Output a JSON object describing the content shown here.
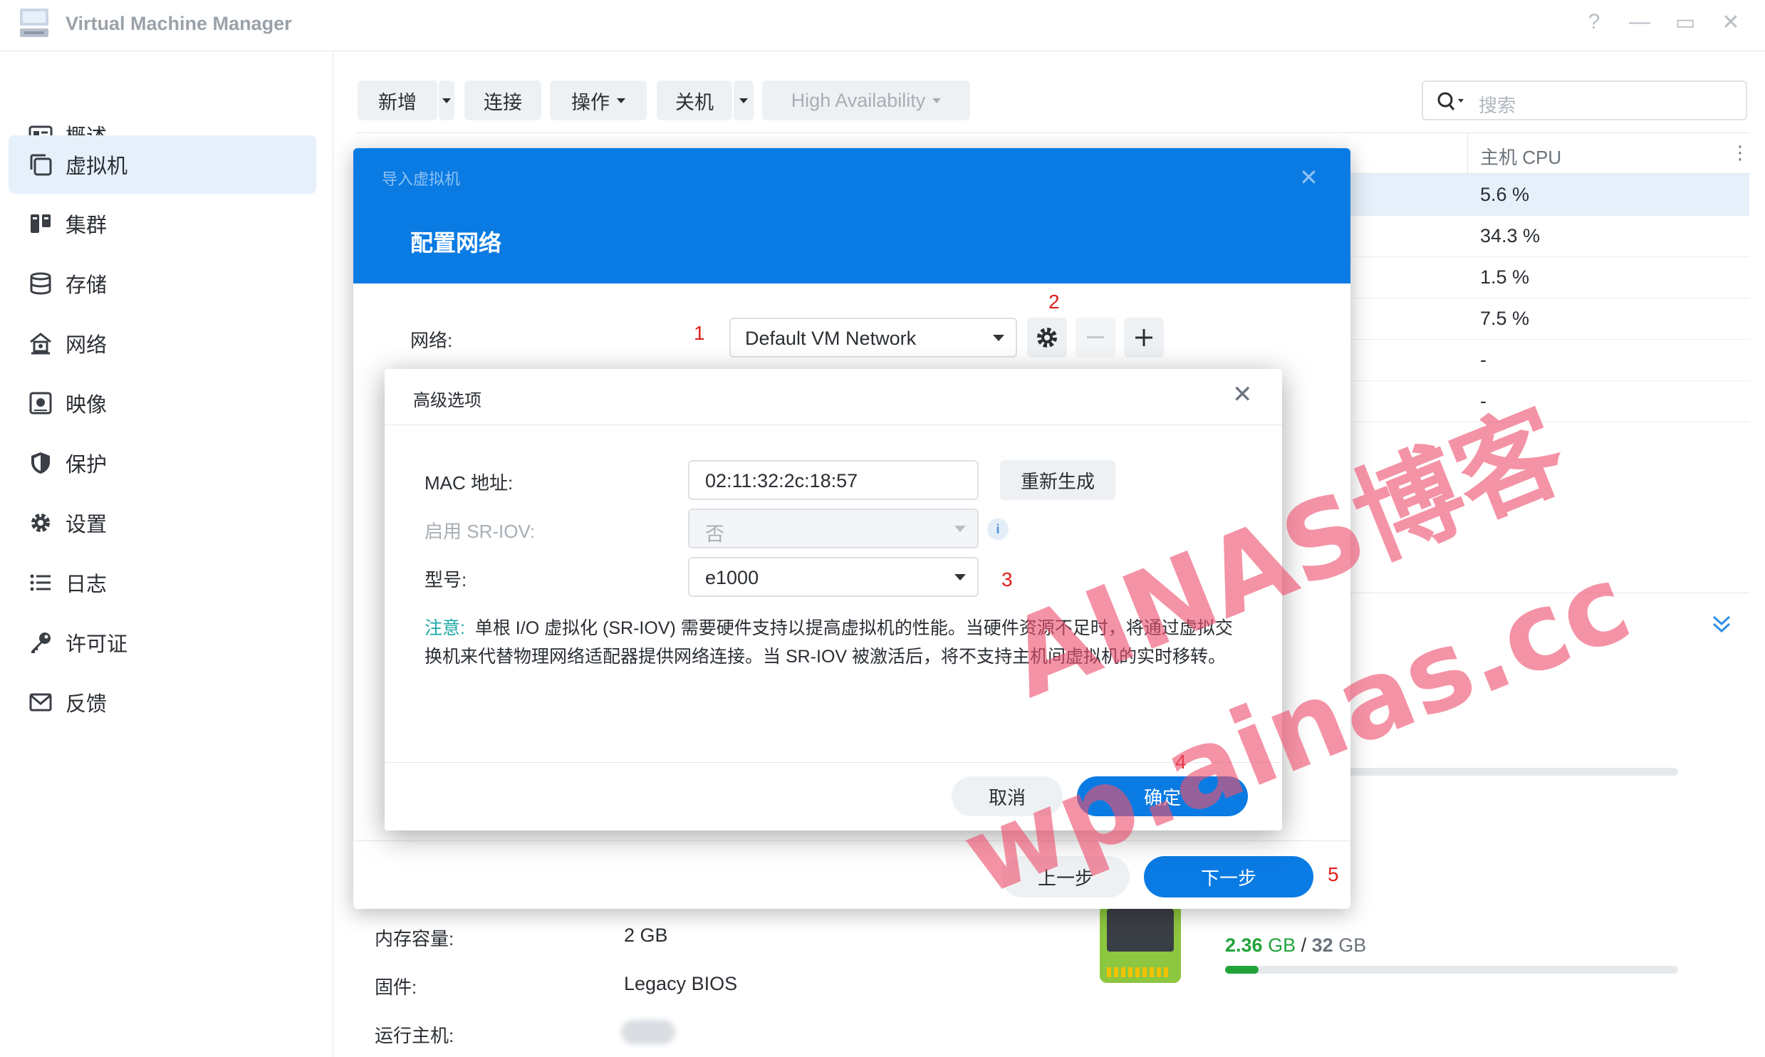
{
  "app": {
    "title": "Virtual Machine Manager"
  },
  "window_controls": {
    "help": "?",
    "minimize": "—",
    "maximize": "▭",
    "close": "✕"
  },
  "sidebar": {
    "items": [
      {
        "label": "概述",
        "icon": "overview-icon"
      },
      {
        "label": "虚拟机",
        "icon": "vm-icon",
        "active": true
      },
      {
        "label": "集群",
        "icon": "cluster-icon"
      },
      {
        "label": "存储",
        "icon": "storage-icon"
      },
      {
        "label": "网络",
        "icon": "network-icon"
      },
      {
        "label": "映像",
        "icon": "image-icon"
      },
      {
        "label": "保护",
        "icon": "shield-icon"
      },
      {
        "label": "设置",
        "icon": "gear-icon"
      },
      {
        "label": "日志",
        "icon": "log-icon"
      },
      {
        "label": "许可证",
        "icon": "key-icon"
      },
      {
        "label": "反馈",
        "icon": "mail-icon"
      }
    ]
  },
  "toolbar": {
    "add": "新增",
    "connect": "连接",
    "action": "操作",
    "shutdown": "关机",
    "ha": "High Availability",
    "search_placeholder": "搜索"
  },
  "table": {
    "host_cpu_header": "主机 CPU",
    "host_cpu_values": [
      "5.6 %",
      "34.3 %",
      "1.5 %",
      "7.5 %",
      "-",
      "-"
    ]
  },
  "details": {
    "memory_label": "内存容量:",
    "memory_value": "2 GB",
    "firmware_label": "固件:",
    "firmware_value": "Legacy BIOS",
    "host_label": "运行主机:",
    "host_memory_used": "2.36",
    "host_memory_unit1": "GB",
    "host_memory_sep": "/",
    "host_memory_total": "32",
    "host_memory_unit2": "GB",
    "host_memory_fraction": 0.074
  },
  "import_dialog": {
    "subtitle": "导入虚拟机",
    "title": "配置网络",
    "network_label": "网络:",
    "network_value": "Default VM Network",
    "prev": "上一步",
    "next": "下一步"
  },
  "advanced_dialog": {
    "title": "高级选项",
    "mac_label": "MAC 地址:",
    "mac_value": "02:11:32:2c:18:57",
    "regen": "重新生成",
    "sriov_label": "启用 SR-IOV:",
    "sriov_value": "否",
    "model_label": "型号:",
    "model_value": "e1000",
    "note_tag": "注意:",
    "note_text": "单根 I/O 虚拟化 (SR-IOV) 需要硬件支持以提高虚拟机的性能。当硬件资源不足时，将通过虚拟交换机来代替物理网络适配器提供网络连接。当 SR-IOV 被激活后，将不支持主机间虚拟机的实时移转。",
    "cancel": "取消",
    "ok": "确定"
  },
  "annotations": {
    "n1": "1",
    "n2": "2",
    "n3": "3",
    "n4": "4",
    "n5": "5"
  },
  "watermark": {
    "line1": "AINAS博客",
    "line2": "wp.ainas.cc"
  },
  "colors": {
    "primary": "#0a7be3",
    "accent_red": "#e0201b",
    "mem_green": "#22a33a",
    "note_teal": "#1aa6a6"
  }
}
